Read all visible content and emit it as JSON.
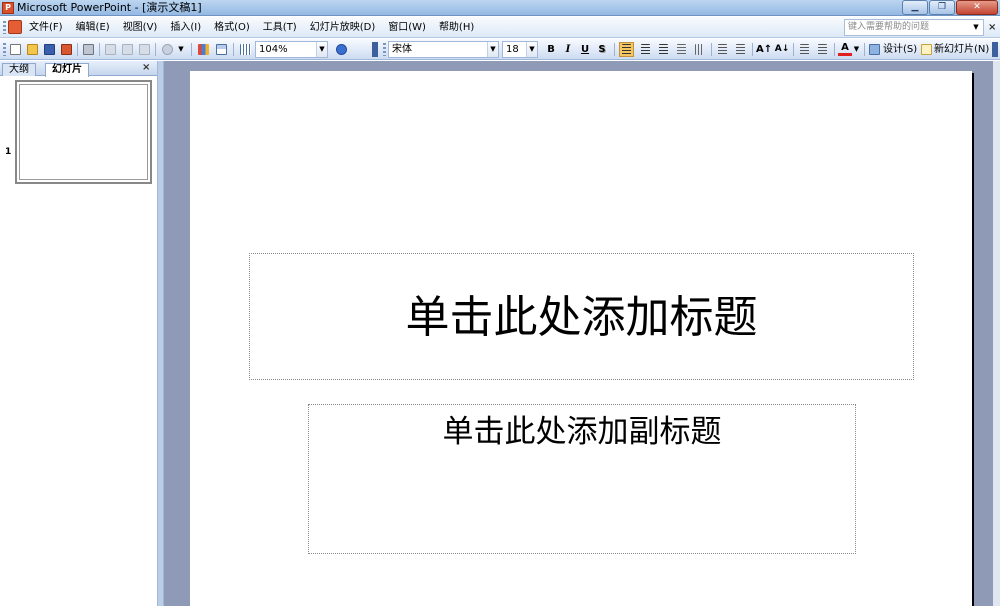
{
  "window": {
    "title": "Microsoft PowerPoint - [演示文稿1]",
    "buttons": [
      "▁",
      "❐",
      "✕"
    ]
  },
  "menu": {
    "items": [
      "文件(F)",
      "编辑(E)",
      "视图(V)",
      "插入(I)",
      "格式(O)",
      "工具(T)",
      "幻灯片放映(D)",
      "窗口(W)",
      "帮助(H)"
    ],
    "help_placeholder": "键入需要帮助的问题",
    "close": "×"
  },
  "toolbar": {
    "zoom": "104%",
    "font_name": "宋体",
    "font_size": "18",
    "bold": "B",
    "italic": "I",
    "underline": "U",
    "shadow": "S",
    "font_grow": "A↑",
    "font_shrink": "A↓",
    "font_color": "A",
    "design_label": "设计(S)",
    "new_slide_label": "新幻灯片(N)"
  },
  "panel": {
    "tabs": [
      "大纲",
      "幻灯片"
    ],
    "active_tab": "幻灯片",
    "close": "×",
    "slide_number": "1"
  },
  "slide": {
    "title_placeholder": "单击此处添加标题",
    "subtitle_placeholder": "单击此处添加副标题"
  },
  "colors": {
    "workspace": "#8f9bb6",
    "toolbar_active": "#f6c660",
    "app_icon": "#d9502c"
  }
}
